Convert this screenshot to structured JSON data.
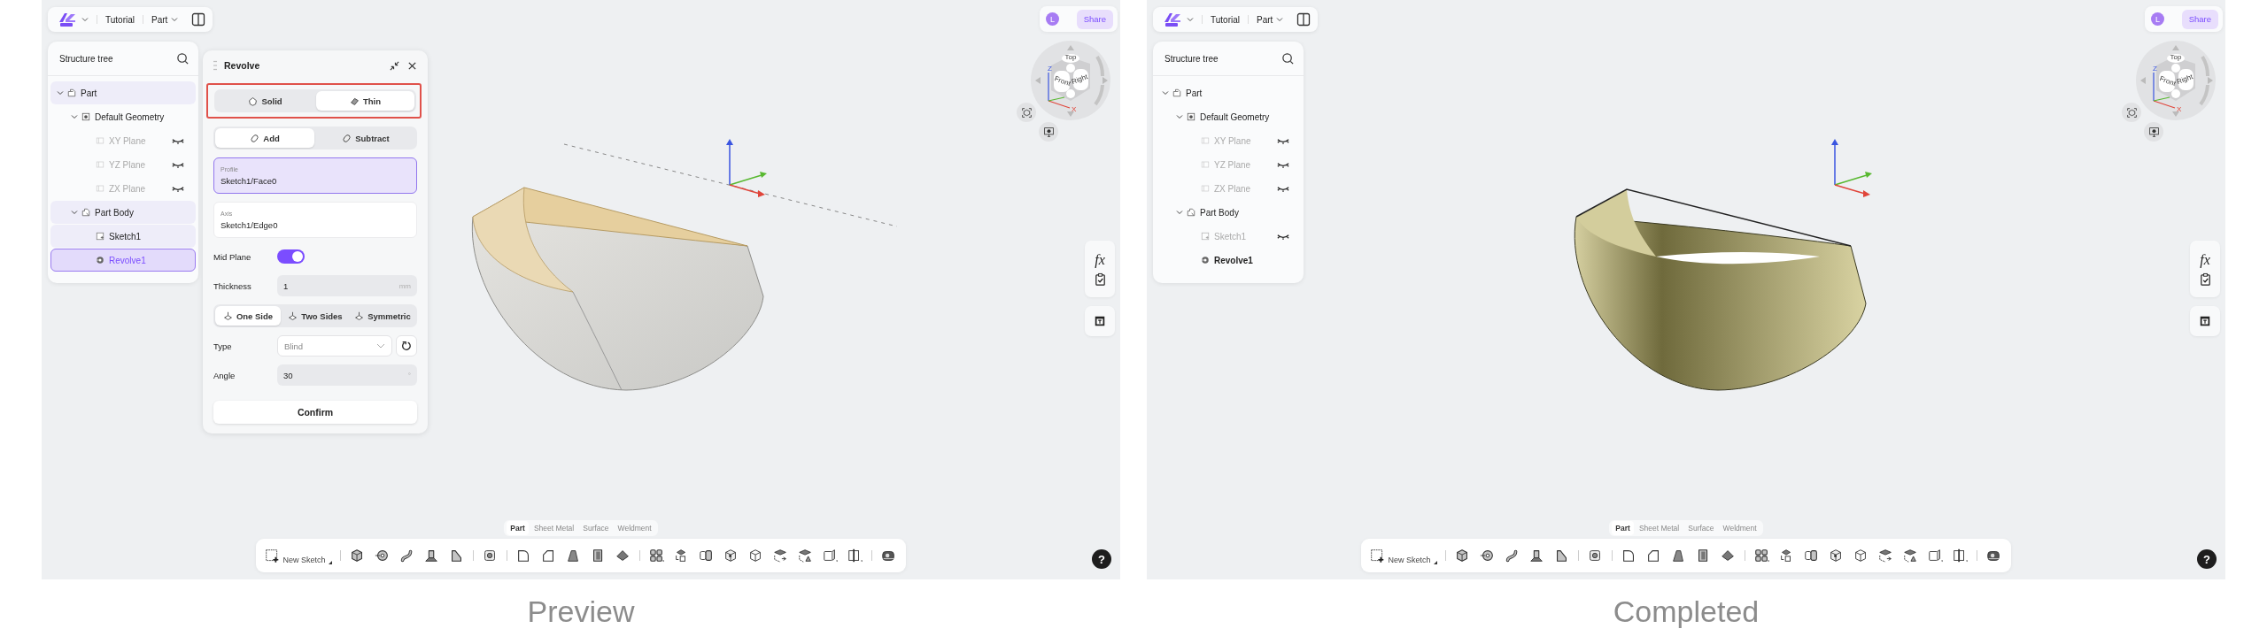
{
  "screens": [
    {
      "caption": "Preview",
      "top_bar": {
        "project": "Tutorial",
        "mode": "Part"
      },
      "user": {
        "initial": "L",
        "share": "Share"
      },
      "tree": {
        "title": "Structure tree",
        "items": [
          {
            "label": "Part",
            "kind": "part",
            "expanded": true,
            "hidden": false,
            "highlighted": true,
            "selected": false,
            "active": false,
            "children": [
              {
                "label": "Default Geometry",
                "kind": "geometry",
                "expanded": true,
                "hidden": false,
                "highlighted": false,
                "selected": false,
                "active": false,
                "children": [
                  {
                    "label": "XY Plane",
                    "kind": "plane",
                    "hidden": true,
                    "highlighted": false,
                    "selected": false,
                    "active": false
                  },
                  {
                    "label": "YZ Plane",
                    "kind": "plane",
                    "hidden": true,
                    "highlighted": false,
                    "selected": false,
                    "active": false
                  },
                  {
                    "label": "ZX Plane",
                    "kind": "plane",
                    "hidden": true,
                    "highlighted": false,
                    "selected": false,
                    "active": false
                  }
                ]
              },
              {
                "label": "Part Body",
                "kind": "body",
                "expanded": true,
                "hidden": false,
                "highlighted": true,
                "selected": false,
                "active": false,
                "children": [
                  {
                    "label": "Sketch1",
                    "kind": "sketch",
                    "hidden": false,
                    "highlighted": true,
                    "selected": false,
                    "active": false
                  },
                  {
                    "label": "Revolve1",
                    "kind": "feature",
                    "hidden": false,
                    "highlighted": false,
                    "selected": true,
                    "active": false
                  }
                ]
              }
            ]
          }
        ]
      },
      "revolve_panel": {
        "title": "Revolve",
        "body_type": {
          "highlighted": true,
          "options": [
            {
              "label": "Solid",
              "selected": false
            },
            {
              "label": "Thin",
              "selected": true
            }
          ]
        },
        "operation": {
          "options": [
            {
              "label": "Add",
              "selected": true
            },
            {
              "label": "Subtract",
              "selected": false
            }
          ]
        },
        "selections": [
          {
            "label": "Profile",
            "value": "Sketch1/Face0",
            "focused": true
          },
          {
            "label": "Axis",
            "value": "Sketch1/Edge0",
            "focused": false
          }
        ],
        "mid_plane": {
          "label": "Mid Plane",
          "on": true
        },
        "thickness": {
          "label": "Thickness",
          "value": "1",
          "unit": "mm"
        },
        "direction": {
          "options": [
            {
              "label": "One Side",
              "selected": true
            },
            {
              "label": "Two Sides",
              "selected": false
            },
            {
              "label": "Symmetric",
              "selected": false
            }
          ]
        },
        "type": {
          "label": "Type",
          "value": "Blind"
        },
        "angle": {
          "label": "Angle",
          "value": "30",
          "unit": "°"
        },
        "confirm": "Confirm"
      },
      "model": {
        "kind": "preview"
      },
      "view_cube": {
        "faces": [
          "Top",
          "Front",
          "Right"
        ],
        "axes": [
          "Z",
          "X"
        ]
      },
      "side_tools": {
        "formula": "fx"
      },
      "workbench_tabs": [
        {
          "label": "Part",
          "selected": true
        },
        {
          "label": "Sheet Metal",
          "selected": false
        },
        {
          "label": "Surface",
          "selected": false
        },
        {
          "label": "Weldment",
          "selected": false
        }
      ],
      "toolbar": {
        "new_sketch": "New Sketch"
      },
      "help": "?"
    },
    {
      "caption": "Completed",
      "top_bar": {
        "project": "Tutorial",
        "mode": "Part"
      },
      "user": {
        "initial": "L",
        "share": "Share"
      },
      "tree": {
        "title": "Structure tree",
        "items": [
          {
            "label": "Part",
            "kind": "part",
            "expanded": true,
            "hidden": false,
            "highlighted": false,
            "selected": false,
            "active": false,
            "children": [
              {
                "label": "Default Geometry",
                "kind": "geometry",
                "expanded": true,
                "hidden": false,
                "highlighted": false,
                "selected": false,
                "active": false,
                "children": [
                  {
                    "label": "XY Plane",
                    "kind": "plane",
                    "hidden": true,
                    "highlighted": false,
                    "selected": false,
                    "active": false
                  },
                  {
                    "label": "YZ Plane",
                    "kind": "plane",
                    "hidden": true,
                    "highlighted": false,
                    "selected": false,
                    "active": false
                  },
                  {
                    "label": "ZX Plane",
                    "kind": "plane",
                    "hidden": true,
                    "highlighted": false,
                    "selected": false,
                    "active": false
                  }
                ]
              },
              {
                "label": "Part Body",
                "kind": "body",
                "expanded": true,
                "hidden": false,
                "highlighted": false,
                "selected": false,
                "active": false,
                "children": [
                  {
                    "label": "Sketch1",
                    "kind": "sketch",
                    "hidden": true,
                    "highlighted": false,
                    "selected": false,
                    "active": false
                  },
                  {
                    "label": "Revolve1",
                    "kind": "feature",
                    "hidden": false,
                    "highlighted": false,
                    "selected": false,
                    "active": true
                  }
                ]
              }
            ]
          }
        ]
      },
      "model": {
        "kind": "completed"
      },
      "view_cube": {
        "faces": [
          "Top",
          "Front",
          "Right"
        ],
        "axes": [
          "Z",
          "X"
        ]
      },
      "side_tools": {
        "formula": "fx"
      },
      "workbench_tabs": [
        {
          "label": "Part",
          "selected": true
        },
        {
          "label": "Sheet Metal",
          "selected": false
        },
        {
          "label": "Surface",
          "selected": false
        },
        {
          "label": "Weldment",
          "selected": false
        }
      ],
      "toolbar": {
        "new_sketch": "New Sketch"
      },
      "help": "?"
    }
  ]
}
